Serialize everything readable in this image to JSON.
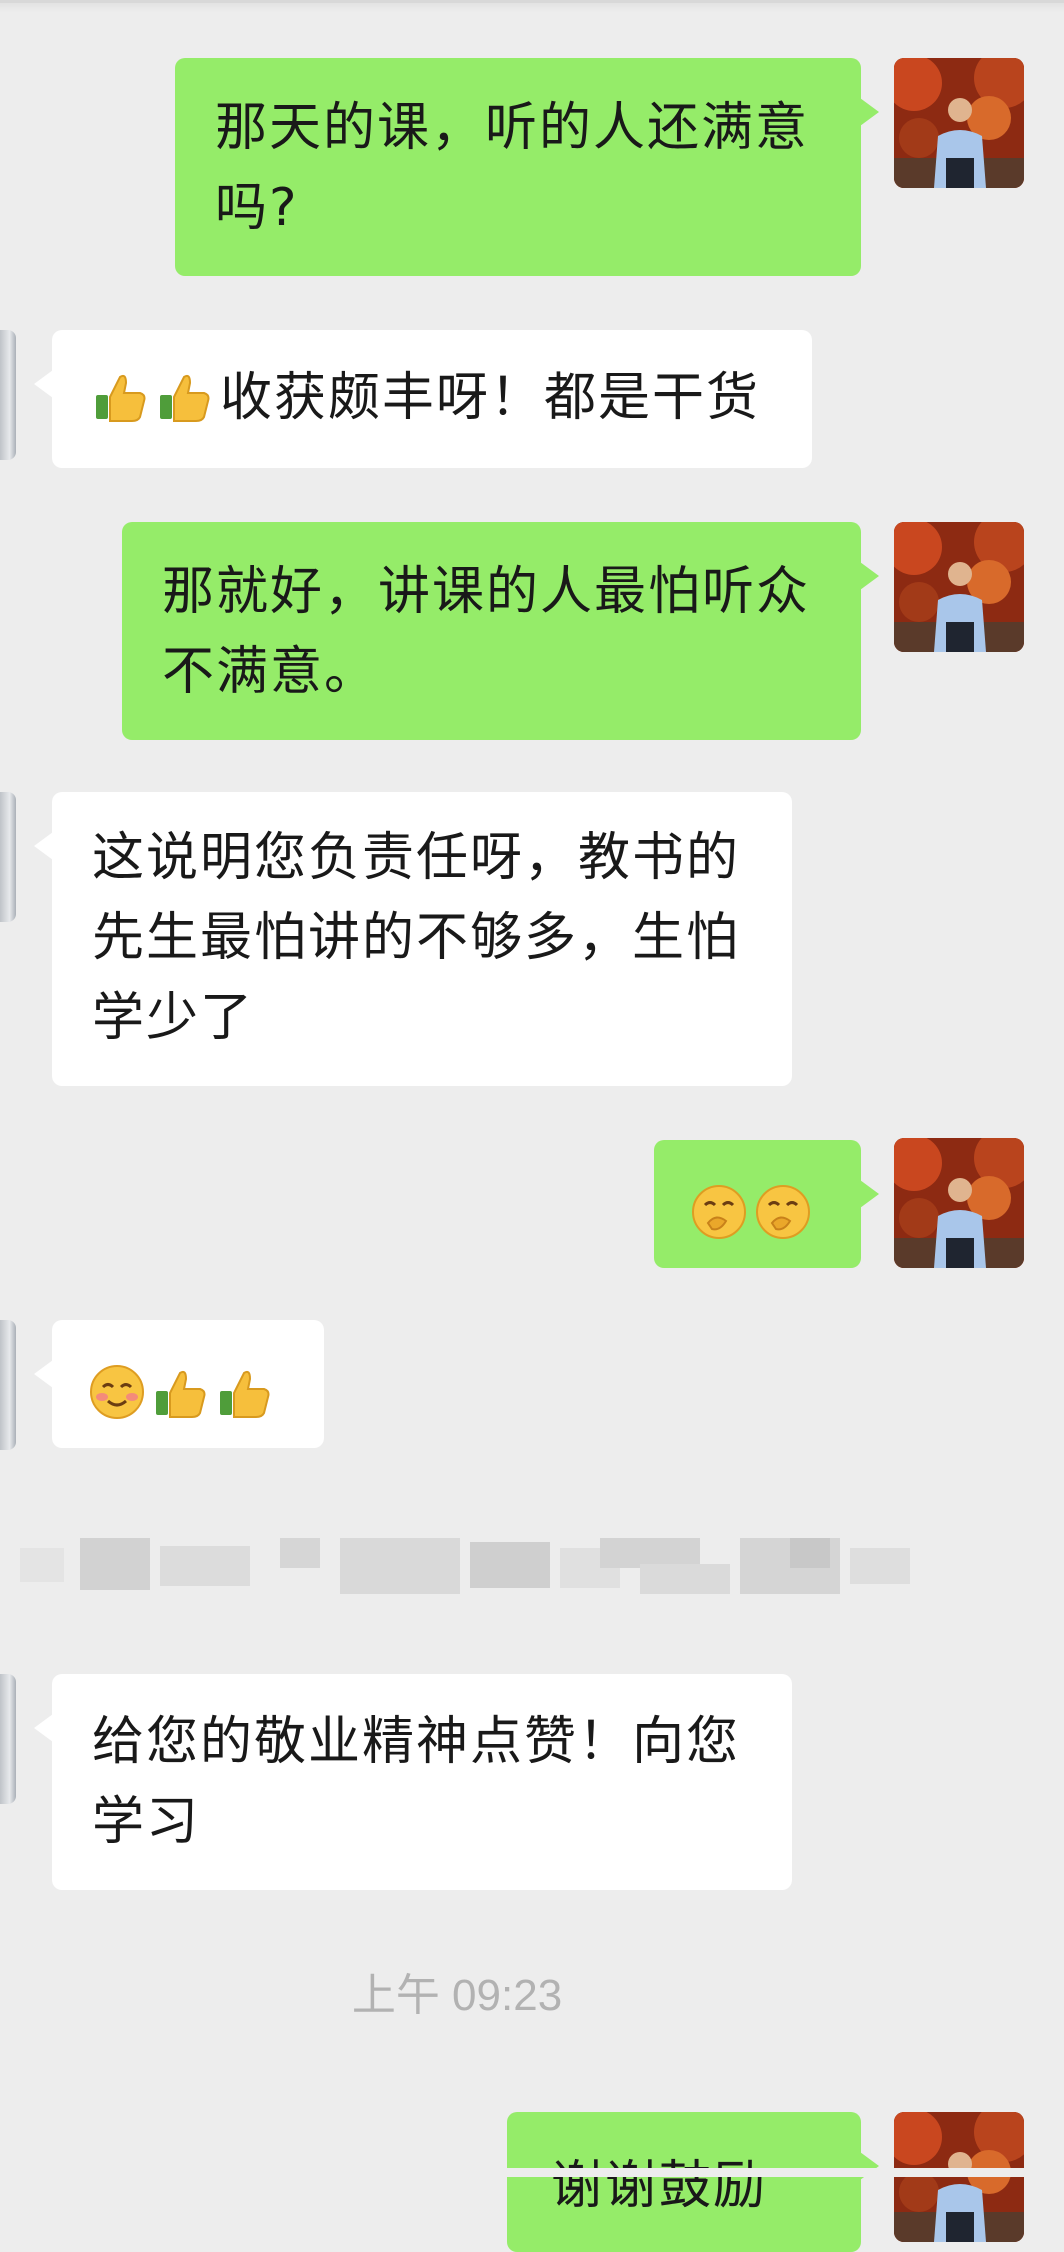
{
  "chat": {
    "messages": [
      {
        "side": "out",
        "text": "那天的课，听的人还满意吗?"
      },
      {
        "side": "in",
        "emoji": [
          "thumbs-up",
          "thumbs-up"
        ],
        "text": "收获颇丰呀！都是干货"
      },
      {
        "side": "out",
        "text": "那就好，讲课的人最怕听众不满意。"
      },
      {
        "side": "in",
        "text": "这说明您负责任呀，教书的先生最怕讲的不够多，生怕学少了"
      },
      {
        "side": "out",
        "emoji": [
          "chuckle-face",
          "chuckle-face"
        ]
      },
      {
        "side": "in",
        "emoji": [
          "smiling-face",
          "thumbs-up",
          "thumbs-up"
        ]
      },
      {
        "side": "in",
        "text": "给您的敬业精神点赞！向您学习"
      },
      {
        "side": "out",
        "text": "谢谢鼓励"
      }
    ],
    "timestamp": "上午 09:23"
  },
  "icons": {
    "avatar_self": "avatar-photo",
    "avatar_other": "avatar-photo-cropped",
    "blurred_row": "pixelated-content"
  },
  "colors": {
    "background": "#ededed",
    "bubble_out": "#95ec69",
    "bubble_in": "#ffffff",
    "timestamp": "#b2b2b2"
  }
}
